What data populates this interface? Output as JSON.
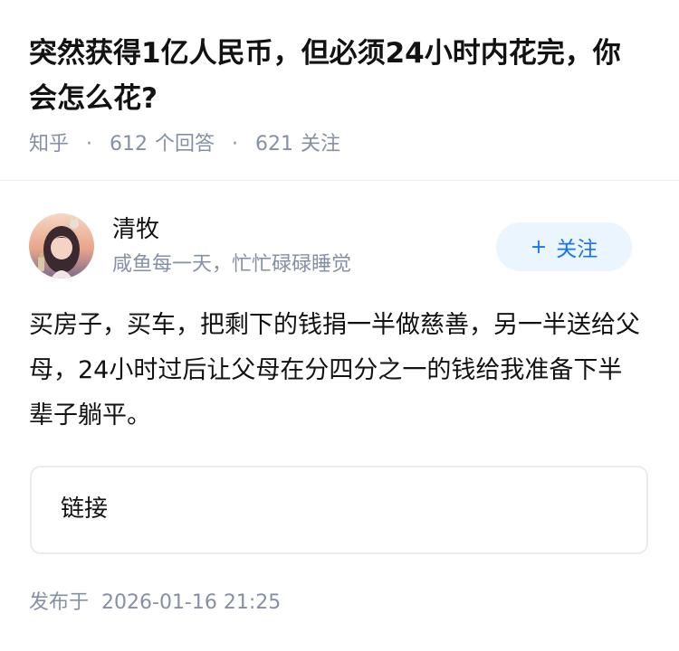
{
  "question": {
    "title": "突然获得1亿人民币，但必须24小时内花完，你会怎么花?",
    "source": "知乎",
    "separator": "·",
    "answer_count": "612",
    "answer_label": "个回答",
    "follower_count": "621",
    "follower_label": "关注"
  },
  "author": {
    "name": "清牧",
    "bio": "咸鱼每一天，忙忙碌碌睡觉",
    "follow_label": "关注",
    "follow_icon": "plus-icon"
  },
  "answer": {
    "text": "买房子，买车，把剩下的钱捐一半做慈善，另一半送给父母，24小时过后让父母在分四分之一的钱给我准备下半辈子躺平。"
  },
  "link_card": {
    "label": "链接"
  },
  "footer": {
    "publish_label": "发布于",
    "publish_date": "2026-01-16 21:25"
  },
  "colors": {
    "title": "#121212",
    "meta": "#8590a6",
    "accent": "#1772f6",
    "follow_bg": "#ebf5fd"
  }
}
